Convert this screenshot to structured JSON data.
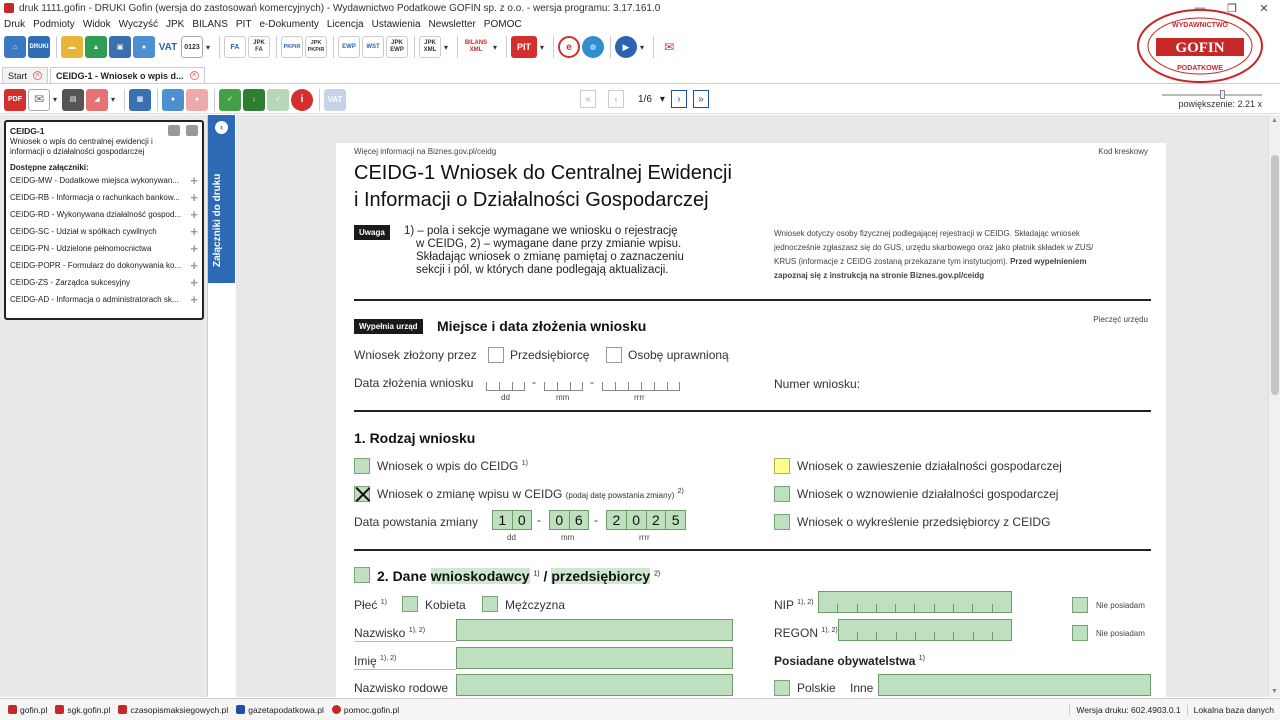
{
  "window": {
    "title": "druk 1111.gofin - DRUKI Gofin (wersja do zastosowań komercyjnych) - Wydawnictwo Podatkowe GOFIN sp. z o.o. - wersja programu: 3.17.161.0"
  },
  "menu": [
    "Druk",
    "Podmioty",
    "Widok",
    "Wyczyść",
    "JPK",
    "BILANS",
    "PIT",
    "e-Dokumenty",
    "Licencja",
    "Ustawienia",
    "Newsletter",
    "POMOC"
  ],
  "toolbar": {
    "druki_label": "DRUKI",
    "vat_label": "VAT",
    "fa_label": "FA",
    "jpk_fa_label": "JPK FA",
    "pkpir_label": "PKPiR",
    "jpk_pkpir_label": "JPK PKPiR",
    "ewp_label": "EWP",
    "wst_label": "WST",
    "jpk_ewp_label": "JPK EWP",
    "jpk_xml_label": "JPK XML",
    "bilans_label": "BILANS XML",
    "pit_label": "PIT"
  },
  "tabs": [
    {
      "label": "Start"
    },
    {
      "label": "CEIDG-1 - Wniosek o wpis d..."
    }
  ],
  "pager": {
    "current": "1/6"
  },
  "zoom": {
    "label": "powiększenie: 2.21 x",
    "level": 0.58
  },
  "logo": {
    "top": "WYDAWNICTWO",
    "name": "GOFIN",
    "bottom": "PODATKOWE"
  },
  "attachments": {
    "title": "CEIDG-1",
    "description": "Wniosek o wpis do centralnej ewidencji i informacji o działalności gospodarczej",
    "available_label": "Dostępne załączniki:",
    "items": [
      "CEIDG-MW - Dodatkowe miejsca wykonywan...",
      "CEIDG-RB - Informacja o rachunkach bankow...",
      "CEIDG-RD - Wykonywana działalność gospod...",
      "CEIDG-SC - Udział w spółkach cywilnych",
      "CEIDG-PN - Udzielone pełnomocnictwa",
      "CEIDG-POPR - Formularz do dokonywania ko...",
      "CEIDG-ZS - Zarządca sukcesyjny",
      "CEIDG-AD - Informacja o administratorach sk..."
    ],
    "side_tab": "Załączniki do druku"
  },
  "form": {
    "info_link": "Więcej informacji na Biznes.gov.pl/ceidg",
    "barcode": "Kod kreskowy",
    "title_line1": "CEIDG-1 Wniosek do Centralnej Ewidencji",
    "title_line2": "i Informacji o Działalności Gospodarczej",
    "notice_badge": "Uwaga",
    "notice_l1": "1) – pola i sekcje wymagane we wniosku o rejestrację",
    "notice_l2": "w CEIDG, 2) – wymagane dane przy zmianie wpisu.",
    "notice_l3": "Składając wniosek o zmianę pamiętaj o zaznaczeniu",
    "notice_l4": "sekcji i pól, w których dane podlegają aktualizacji.",
    "info_l1": "Wniosek dotyczy osoby fizycznej podlegającej rejestracji w CEIDG. Składając wniosek",
    "info_l2": "jednocześnie zgłaszasz się do GUS, urzędu skarbowego oraz jako płatnik składek w ZUS/",
    "info_l3": "KRUS (informacje z CEIDG zostaną przekazane tym instytucjom).",
    "info_bold1": "Przed wypełnieniem",
    "info_bold2": "zapoznaj się z instrukcją na stronie Biznes.gov.pl/ceidg",
    "office_badge": "Wypełnia urząd",
    "office_title": "Miejsce i data złożenia wniosku",
    "office_stamp": "Pieczęć urzędu",
    "submitted_by": "Wniosek złożony przez",
    "opt_entrepreneur": "Przedsiębiorcę",
    "opt_authorized": "Osobę uprawnioną",
    "submission_date": "Data złożenia wniosku",
    "app_number": "Numer wniosku:",
    "dd": "dd",
    "mm": "mm",
    "rrrr": "rrrr",
    "s1_title": "1. Rodzaj wniosku",
    "s1_opt1": "Wniosek o wpis do CEIDG",
    "s1_opt1_sup": "1)",
    "s1_opt2": "Wniosek o zmianę wpisu w CEIDG",
    "s1_opt2_note": "(podaj datę powstania zmiany)",
    "s1_opt2_sup": "2)",
    "s1_change_date": "Data powstania zmiany",
    "s1_date_day": [
      "1",
      "0"
    ],
    "s1_date_month": [
      "0",
      "6"
    ],
    "s1_date_year": [
      "2",
      "0",
      "2",
      "5"
    ],
    "s1_opt3": "Wniosek o zawieszenie działalności gospodarczej",
    "s1_opt4": "Wniosek o wznowienie działalności gospodarczej",
    "s1_opt5": "Wniosek o wykreślenie przedsiębiorcy z CEIDG",
    "s2_title_a": "2. Dane",
    "s2_title_b": "wnioskodawcy",
    "s2_sup1": "1)",
    "s2_slash": "/",
    "s2_title_c": "przedsiębiorcy",
    "s2_sup2": "2)",
    "gender": "Płeć",
    "gender_sup": "1)",
    "female": "Kobieta",
    "male": "Mężczyzna",
    "surname": "Nazwisko",
    "surname_sup": "1), 2)",
    "first_name": "Imię",
    "first_name_sup": "1), 2)",
    "family_name": "Nazwisko rodowe",
    "nip": "NIP",
    "nip_sup": "1), 2)",
    "regon": "REGON",
    "regon_sup": "1), 2)",
    "none1": "Nie posiadam",
    "none2": "Nie posiadam",
    "citizenship": "Posiadane obywatelstwa",
    "citizenship_sup": "1)",
    "polish": "Polskie",
    "other": "Inne"
  },
  "status": {
    "links": [
      "gofin.pl",
      "sgk.gofin.pl",
      "czasopismaksiegowych.pl",
      "gazetapodatkowa.pl",
      "pomoc.gofin.pl"
    ],
    "version": "Wersja druku: 602.4903.0.1",
    "database": "Lokalna baza danych"
  }
}
